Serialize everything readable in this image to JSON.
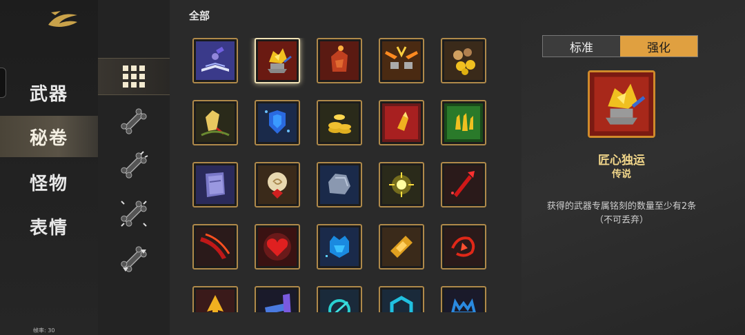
{
  "sidebar": {
    "items": [
      {
        "label": "武器",
        "active": false
      },
      {
        "label": "秘卷",
        "active": true
      },
      {
        "label": "怪物",
        "active": false
      },
      {
        "label": "表情",
        "active": false
      }
    ],
    "fps_label": "帧率: 30"
  },
  "filters": {
    "items": [
      {
        "icon": "grid-all-icon",
        "active": true
      },
      {
        "icon": "bone-tier1-icon",
        "active": false
      },
      {
        "icon": "bone-tier2-icon",
        "active": false
      },
      {
        "icon": "bone-tier3-icon",
        "active": false
      },
      {
        "icon": "bone-down-icon",
        "active": false
      }
    ]
  },
  "grid": {
    "title": "全部",
    "tiles": [
      {
        "icon": "magic-book-icon"
      },
      {
        "icon": "artisan-anvil-icon",
        "selected": true
      },
      {
        "icon": "fire-fist-icon"
      },
      {
        "icon": "forge-hammers-icon"
      },
      {
        "icon": "gold-coins-icon"
      },
      {
        "icon": "golden-glove-icon"
      },
      {
        "icon": "blue-shield-icon"
      },
      {
        "icon": "coin-stack-icon"
      },
      {
        "icon": "golden-bullet-icon"
      },
      {
        "icon": "triple-bullets-icon"
      },
      {
        "icon": "purple-tome-icon"
      },
      {
        "icon": "scroll-spiral-icon"
      },
      {
        "icon": "grey-stone-icon"
      },
      {
        "icon": "glowing-orb-icon"
      },
      {
        "icon": "red-blade-icon"
      },
      {
        "icon": "red-slash-icon"
      },
      {
        "icon": "red-heart-icon"
      },
      {
        "icon": "blue-crown-shield-icon"
      },
      {
        "icon": "gold-bandage-icon"
      },
      {
        "icon": "red-swirl-icon"
      },
      {
        "icon": "gold-arrow-icon"
      },
      {
        "icon": "crystal-icon"
      },
      {
        "icon": "cyan-rune-icon"
      },
      {
        "icon": "cyan-hex-icon"
      },
      {
        "icon": "blue-horns-icon"
      }
    ]
  },
  "detail": {
    "tabs": [
      {
        "label": "标准",
        "active": false
      },
      {
        "label": "强化",
        "active": true
      }
    ],
    "name": "匠心独运",
    "rarity": "传说",
    "description": "获得的武器专属铭刻的数量至少有2条（不可丢弃）",
    "icon": "artisan-anvil-icon"
  },
  "colors": {
    "accent": "#e0a040",
    "tile_border": "#b08a4a",
    "legend_text": "#f1d68a"
  }
}
